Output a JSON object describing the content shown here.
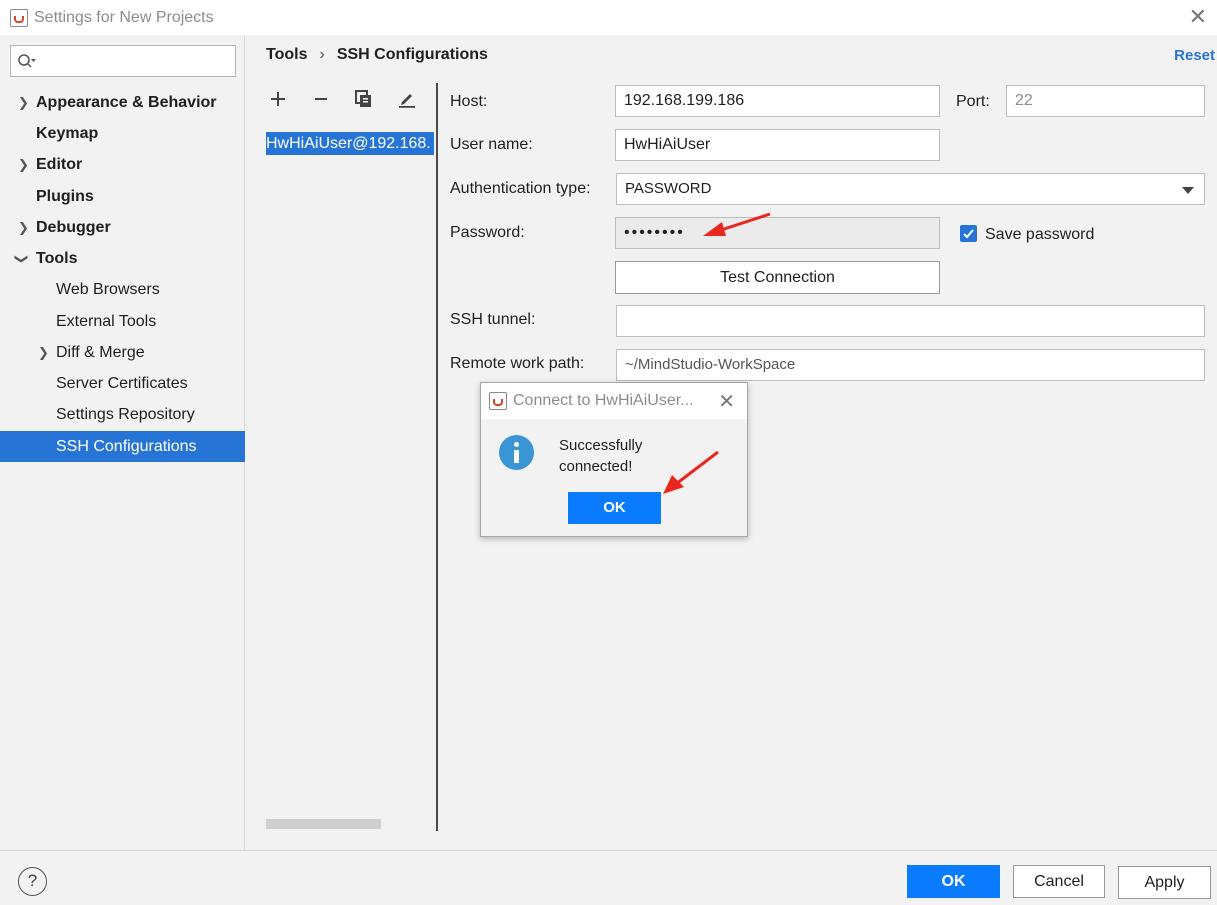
{
  "window": {
    "title": "Settings for New Projects"
  },
  "search": {
    "value": "",
    "placeholder": ""
  },
  "sidebar": {
    "items": [
      {
        "label": "Appearance & Behavior"
      },
      {
        "label": "Keymap"
      },
      {
        "label": "Editor"
      },
      {
        "label": "Plugins"
      },
      {
        "label": "Debugger"
      },
      {
        "label": "Tools"
      },
      {
        "label": "Web Browsers"
      },
      {
        "label": "External Tools"
      },
      {
        "label": "Diff & Merge"
      },
      {
        "label": "Server Certificates"
      },
      {
        "label": "Settings Repository"
      },
      {
        "label": "SSH Configurations"
      }
    ],
    "selected": "SSH Configurations"
  },
  "breadcrumb": {
    "parent": "Tools",
    "current": "SSH Configurations"
  },
  "reset_label": "Reset",
  "config_list": {
    "items": [
      "HwHiAiUser@192.168."
    ]
  },
  "form": {
    "host_label": "Host:",
    "host_value": "192.168.199.186",
    "port_label": "Port:",
    "port_value": "22",
    "user_label": "User name:",
    "user_value": "HwHiAiUser",
    "auth_label": "Authentication type:",
    "auth_value": "PASSWORD",
    "password_label": "Password:",
    "password_value": "••••••••",
    "save_password_label": "Save password",
    "save_password_checked": true,
    "test_connection_label": "Test Connection",
    "ssh_tunnel_label": "SSH tunnel:",
    "ssh_tunnel_value": "",
    "remote_path_label": "Remote work path:",
    "remote_path_value": "~/MindStudio-WorkSpace"
  },
  "dialog": {
    "title": "Connect to HwHiAiUser...",
    "message": "Successfully connected!",
    "ok_label": "OK"
  },
  "buttons": {
    "help": "?",
    "ok": "OK",
    "cancel": "Cancel",
    "apply": "Apply"
  },
  "colors": {
    "accent": "#2675d6",
    "primary_button": "#0a7bff",
    "annotation_arrow": "#e8281e",
    "info_icon": "#3a95d5"
  }
}
